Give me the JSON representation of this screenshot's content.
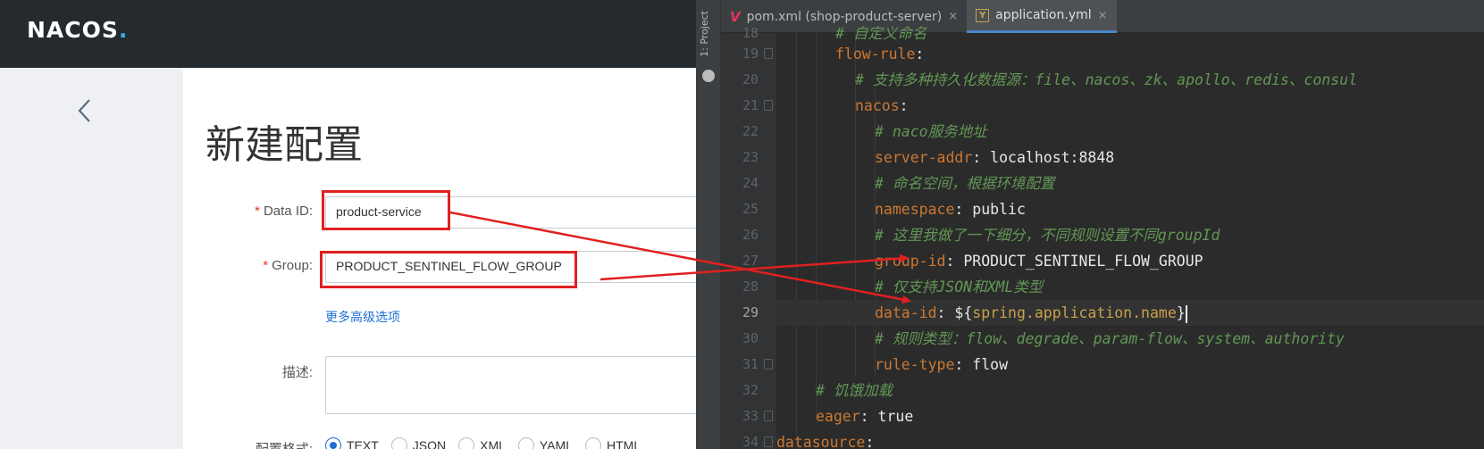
{
  "nacos": {
    "logo": "NACOS",
    "logo_dot": ".",
    "page_title": "新建配置",
    "back_icon": "chevron-left-icon",
    "fields": {
      "data_id": {
        "label": "Data ID:",
        "required": "*",
        "value": "product-service"
      },
      "group": {
        "label": "Group:",
        "required": "*",
        "value": "PRODUCT_SENTINEL_FLOW_GROUP"
      },
      "advanced_link": "更多高级选项",
      "description": {
        "label": "描述:",
        "value": ""
      },
      "format": {
        "label": "配置格式:",
        "options": [
          "TEXT",
          "JSON",
          "XML",
          "YAML",
          "HTML"
        ],
        "selected": "TEXT"
      }
    },
    "colors": {
      "header": "#252a2f",
      "required": "#e6321e",
      "link": "#1e6fd6",
      "annotation": "#e02020"
    }
  },
  "ide": {
    "side_strip_label": "1: Project",
    "tabs": [
      {
        "label": "pom.xml (shop-product-server)",
        "icon": "maven-icon",
        "close": "×",
        "active": false
      },
      {
        "label": "application.yml",
        "icon": "yaml-icon",
        "close": "×",
        "active": true
      }
    ],
    "lines": [
      {
        "num": "18",
        "text": "# 自定义命名"
      },
      {
        "num": "19",
        "key": "flow-rule",
        "sep": ":"
      },
      {
        "num": "20",
        "comment": "# 支持多种持久化数据源：file、nacos、zk、apollo、redis、consul"
      },
      {
        "num": "21",
        "key": "nacos",
        "sep": ":"
      },
      {
        "num": "22",
        "comment": "# naco服务地址"
      },
      {
        "num": "23",
        "key": "server-addr",
        "sep": ": ",
        "value": "localhost:8848"
      },
      {
        "num": "24",
        "comment": "# 命名空间，根据环境配置"
      },
      {
        "num": "25",
        "key": "namespace",
        "sep": ": ",
        "value": "public"
      },
      {
        "num": "26",
        "comment": "# 这里我做了一下细分，不同规则设置不同groupId"
      },
      {
        "num": "27",
        "key": "group-id",
        "sep": ": ",
        "value": "PRODUCT_SENTINEL_FLOW_GROUP"
      },
      {
        "num": "28",
        "comment": "# 仅支持JSON和XML类型"
      },
      {
        "num": "29",
        "key": "data-id",
        "sep": ": ",
        "value_pre": "${",
        "value_prop": "spring.application.name",
        "value_post": "}"
      },
      {
        "num": "30",
        "comment": "# 规则类型：flow、degrade、param-flow、system、authority"
      },
      {
        "num": "31",
        "key": "rule-type",
        "sep": ": ",
        "value": "flow"
      },
      {
        "num": "32",
        "comment": "# 饥饿加载"
      },
      {
        "num": "33",
        "key": "eager",
        "sep": ": ",
        "value": "true"
      },
      {
        "num": "34",
        "key": "datasource",
        "sep": ":"
      }
    ],
    "current_line": "29",
    "colors": {
      "key": "#cc7832",
      "comment": "#629755",
      "value": "#e8e8e8",
      "property_ref": "#c7a14c"
    }
  }
}
